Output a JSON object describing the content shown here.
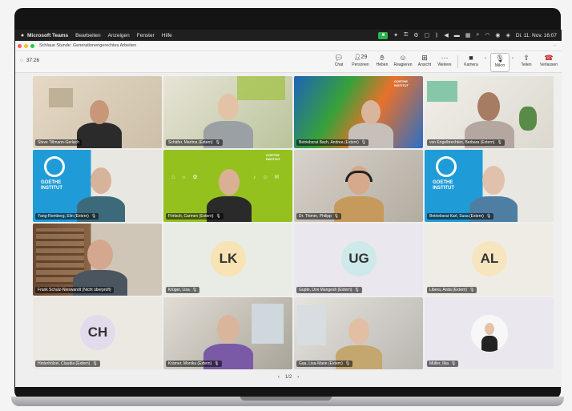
{
  "menubar": {
    "apple": "",
    "app_name": "Microsoft Teams",
    "menus": [
      "Bearbeiten",
      "Anzeigen",
      "Fenster",
      "Hilfe"
    ],
    "datetime": "Di. 11. Nov. 16:07"
  },
  "window": {
    "title": "Schlaue Stunde: Generationengerechtes Arbeiten",
    "more": "···"
  },
  "meeting": {
    "timer": "37:26",
    "participant_count": "29",
    "toolbar": {
      "chat": "Chat",
      "people": "Personen",
      "raise": "Heben",
      "react": "Reagieren",
      "view": "Ansicht",
      "more": "Weitere",
      "camera": "Kamera",
      "mic": "Mikro",
      "share": "Teilen",
      "leave": "Verlassen"
    }
  },
  "tiles": [
    {
      "name": "Steve Tillmann-Gerlach",
      "kind": "video"
    },
    {
      "name": "Schäfer, Martina (Extern)",
      "kind": "video"
    },
    {
      "name": "Betriebsrat Bach, Andrea (Extern)",
      "kind": "video"
    },
    {
      "name": "von Engelbrechten, Barbara (Extern)",
      "kind": "video"
    },
    {
      "name": "Yang-Romberg, Elin (Extern)",
      "kind": "video"
    },
    {
      "name": "Förtsch, Carmen (Extern)",
      "kind": "video"
    },
    {
      "name": "Dr. Thimm, Philipp",
      "kind": "video"
    },
    {
      "name": "Betriebsrat Karl, Susa (Extern)",
      "kind": "video"
    },
    {
      "name": "Frank Schulz-Nieswandt (Nicht überprüft)",
      "kind": "video"
    },
    {
      "name": "Krüger, Lisa",
      "kind": "initials",
      "initials": "LK"
    },
    {
      "name": "Gupte, Urvi Mangesh (Extern)",
      "kind": "initials",
      "initials": "UG"
    },
    {
      "name": "Libera, Anita (Extern)",
      "kind": "initials",
      "initials": "AL"
    },
    {
      "name": "Hinterhölzel, Claudia (Extern)",
      "kind": "initials",
      "initials": "CH"
    },
    {
      "name": "Krämer, Monika (Extern)",
      "kind": "video"
    },
    {
      "name": "Gaa, Lisa-Marie (Extern)",
      "kind": "video"
    },
    {
      "name": "Müller, Ilka",
      "kind": "photo"
    }
  ],
  "goethe": {
    "line1": "GOETHE",
    "line2": "INSTITUT"
  },
  "pager": {
    "prev": "‹",
    "label": "1/2",
    "next": "›"
  },
  "colors": {
    "teams_accent": "#5b5fc7",
    "leave_red": "#c4262e",
    "goethe_blue": "#1f9bd7",
    "lime": "#95c11f",
    "rec_green": "#2bb24c"
  }
}
